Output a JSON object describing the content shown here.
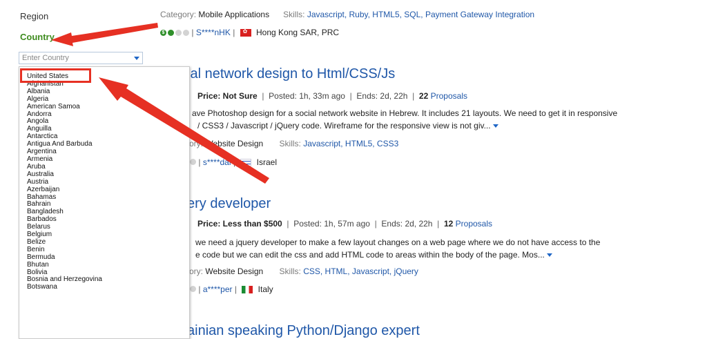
{
  "sidebar": {
    "region_label": "Region",
    "country_label": "Country",
    "country_placeholder": "Enter Country",
    "countries": [
      "United States",
      "Afghanistan",
      "Albania",
      "Algeria",
      "American Samoa",
      "Andorra",
      "Angola",
      "Anguilla",
      "Antarctica",
      "Antigua And Barbuda",
      "Argentina",
      "Armenia",
      "Aruba",
      "Australia",
      "Austria",
      "Azerbaijan",
      "Bahamas",
      "Bahrain",
      "Bangladesh",
      "Barbados",
      "Belarus",
      "Belgium",
      "Belize",
      "Benin",
      "Bermuda",
      "Bhutan",
      "Bolivia",
      "Bosnia and Herzegovina",
      "Botswana"
    ]
  },
  "colors": {
    "link": "#1f57a8",
    "country_label": "#3f8c1f",
    "annotation_red": "#e63023"
  },
  "jobs": [
    {
      "category_label": "Category:",
      "category": "Mobile Applications",
      "skills_label": "Skills:",
      "skills": "Javascript, Ruby, HTML5, SQL, Payment Gateway Integration",
      "user": "S****nHK",
      "location": "Hong Kong SAR, PRC"
    },
    {
      "title": "ial network design to Html/CSS/Js",
      "price": "Price: Not Sure",
      "posted": "Posted: 1h, 33m ago",
      "ends": "Ends: 2d, 22h",
      "proposals_count": "22",
      "proposals_label": "Proposals",
      "desc_line1": "ave Photoshop design for a social network website in Hebrew. It includes 21 layouts. We need to get it in responsive",
      "desc_line2": "/ CSS3 / Javascript / jQuery code. Wireframe for the responsive view is not giv...",
      "category_label": "ory:",
      "category": "Website Design",
      "skills_label": "Skills:",
      "skills": "Javascript, HTML5, CSS3",
      "user": "s****dal",
      "location": "Israel"
    },
    {
      "title": "ery developer",
      "price": "Price: Less than $500",
      "posted": "Posted: 1h, 57m ago",
      "ends": "Ends: 2d, 22h",
      "proposals_count": "12",
      "proposals_label": "Proposals",
      "desc_line1": "we need a jquery developer to make a few layout changes on a web page where we do not have access to the",
      "desc_line2": "e code but we can edit the css and add HTML code to areas within the body of the page. Mos...",
      "category_label": "ory:",
      "category": "Website Design",
      "skills_label": "Skills:",
      "skills": "CSS, HTML, Javascript, jQuery",
      "user": "a****per",
      "location": "Italy"
    },
    {
      "title": "ainian speaking Python/Django expert"
    }
  ]
}
